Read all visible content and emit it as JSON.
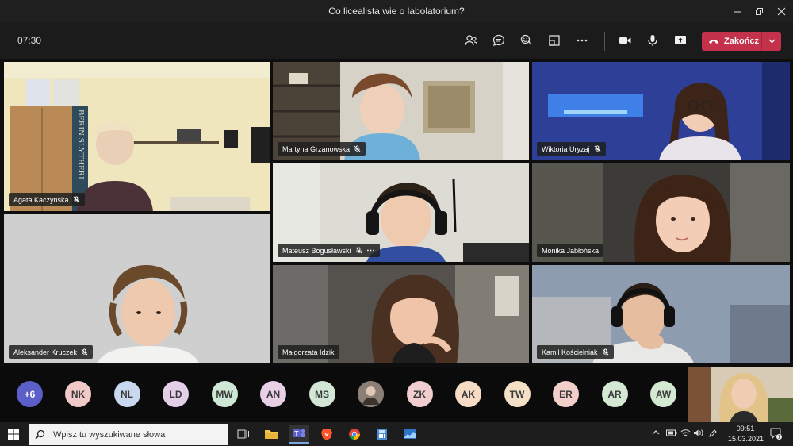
{
  "window": {
    "title": "Co licealista wie o labolatorium?"
  },
  "toolbar": {
    "timer": "07:30",
    "end_label": "Zakończ"
  },
  "tiles": [
    {
      "name": "Agata Kaczyńska"
    },
    {
      "name": "Martyna Grzanowska"
    },
    {
      "name": "Wiktoria Uryzaj"
    },
    {
      "name": "Mateusz Bogusławski"
    },
    {
      "name": "Monika Jabłońska"
    },
    {
      "name": "Aleksander Kruczek"
    },
    {
      "name": "Małgorzata Idzik"
    },
    {
      "name": "Kamil Kościelniak"
    }
  ],
  "background_text": "BERIN SLYTHERI",
  "overflow_count": "+6",
  "roster": [
    {
      "initials": "NK",
      "color": "#f1c9c9"
    },
    {
      "initials": "NL",
      "color": "#c8d9ef"
    },
    {
      "initials": "LD",
      "color": "#e3cfe8"
    },
    {
      "initials": "MW",
      "color": "#cfe8d6"
    },
    {
      "initials": "AN",
      "color": "#ead0e6"
    },
    {
      "initials": "MS",
      "color": "#d3e7d7"
    },
    {
      "initials": "",
      "color": "#8a7e76"
    },
    {
      "initials": "ZK",
      "color": "#f1cdd0"
    },
    {
      "initials": "AK",
      "color": "#f6dcc4"
    },
    {
      "initials": "TW",
      "color": "#f4e0c6"
    },
    {
      "initials": "ER",
      "color": "#f2cfca"
    },
    {
      "initials": "AR",
      "color": "#d5e8d3"
    },
    {
      "initials": "AW",
      "color": "#d4e9d2"
    }
  ],
  "taskbar": {
    "search_placeholder": "Wpisz tu wyszukiwane słowa",
    "time": "09:51",
    "date": "15.03.2021",
    "notification_count": "1"
  },
  "colors": {
    "accent_end": "#c4314b",
    "overflow_avatar": "#5b5fc7"
  }
}
